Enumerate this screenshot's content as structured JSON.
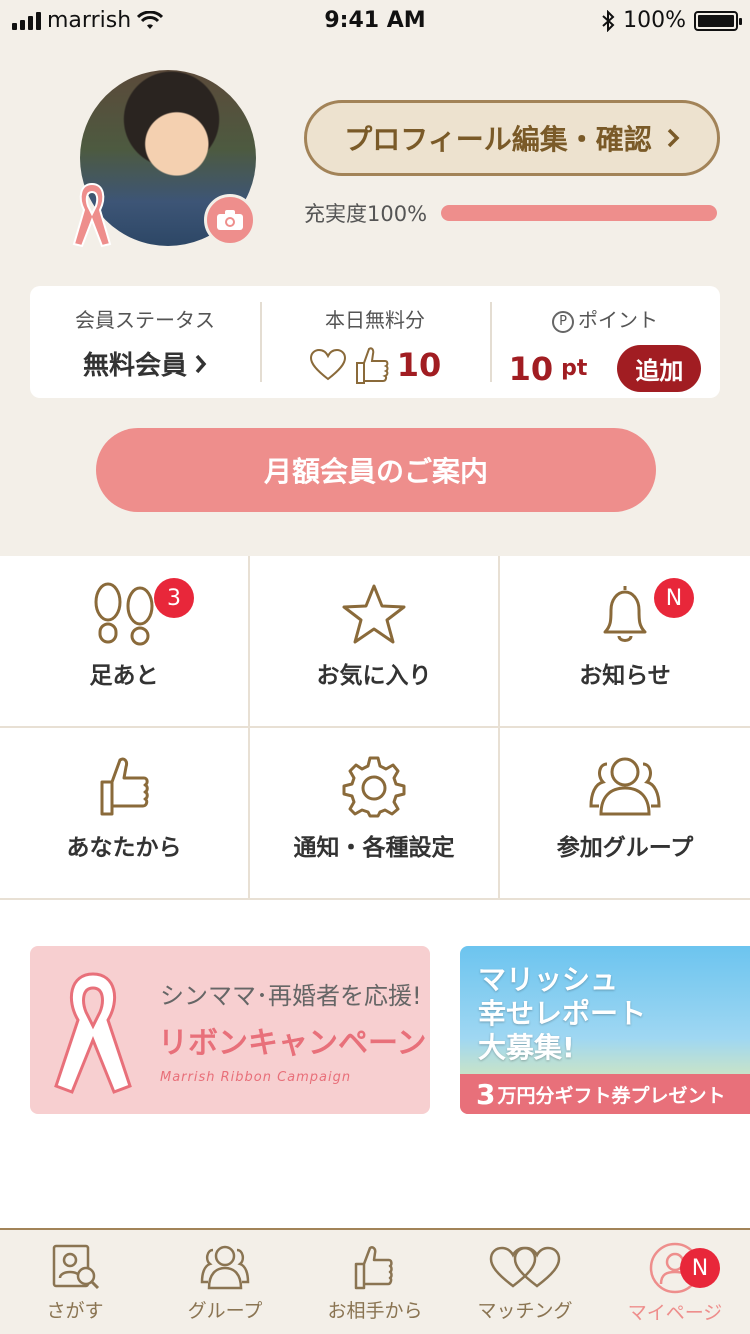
{
  "status_bar": {
    "carrier": "marrish",
    "time": "9:41 AM",
    "battery": "100%"
  },
  "profile": {
    "edit_button": "プロフィール編集・確認",
    "completion_label": "充実度100%",
    "completion_fraction": 1.0
  },
  "stats": {
    "member_label": "会員ステータス",
    "member_value": "無料会員",
    "free_label": "本日無料分",
    "free_value": "10",
    "points_label": "ポイント",
    "points_value": "10",
    "points_unit": "pt",
    "add_button": "追加"
  },
  "monthly_button": "月額会員のご案内",
  "menu": [
    {
      "label": "足あと",
      "icon": "footprints-icon",
      "badge": "3"
    },
    {
      "label": "お気に入り",
      "icon": "star-icon",
      "badge": ""
    },
    {
      "label": "お知らせ",
      "icon": "bell-icon",
      "badge": "N"
    },
    {
      "label": "あなたから",
      "icon": "thumbs-up-icon",
      "badge": ""
    },
    {
      "label": "通知・各種設定",
      "icon": "gear-icon",
      "badge": ""
    },
    {
      "label": "参加グループ",
      "icon": "group-icon",
      "badge": ""
    }
  ],
  "banners": {
    "ribbon": {
      "line1": "シンママ･再婚者を応援!",
      "line2": "リボンキャンペーン",
      "sub": "Marrish Ribbon Campaign"
    },
    "report": {
      "line1": "マリッシュ",
      "line2": "幸せレポート",
      "line3": "大募集!",
      "foot_big": "3",
      "foot_rest": "万円分ギフト券プレゼント"
    }
  },
  "tabs": [
    {
      "label": "さがす",
      "icon": "search-profile-icon"
    },
    {
      "label": "グループ",
      "icon": "group-icon"
    },
    {
      "label": "お相手から",
      "icon": "thumbs-up-icon"
    },
    {
      "label": "マッチング",
      "icon": "hearts-icon"
    },
    {
      "label": "マイページ",
      "icon": "user-icon",
      "badge": "N",
      "active": true
    }
  ],
  "colors": {
    "accent_pink": "#ee8e8c",
    "brown": "#8a6a3a",
    "deep_red": "#a11d22",
    "badge_red": "#e8273a",
    "background": "#f3efe8"
  }
}
